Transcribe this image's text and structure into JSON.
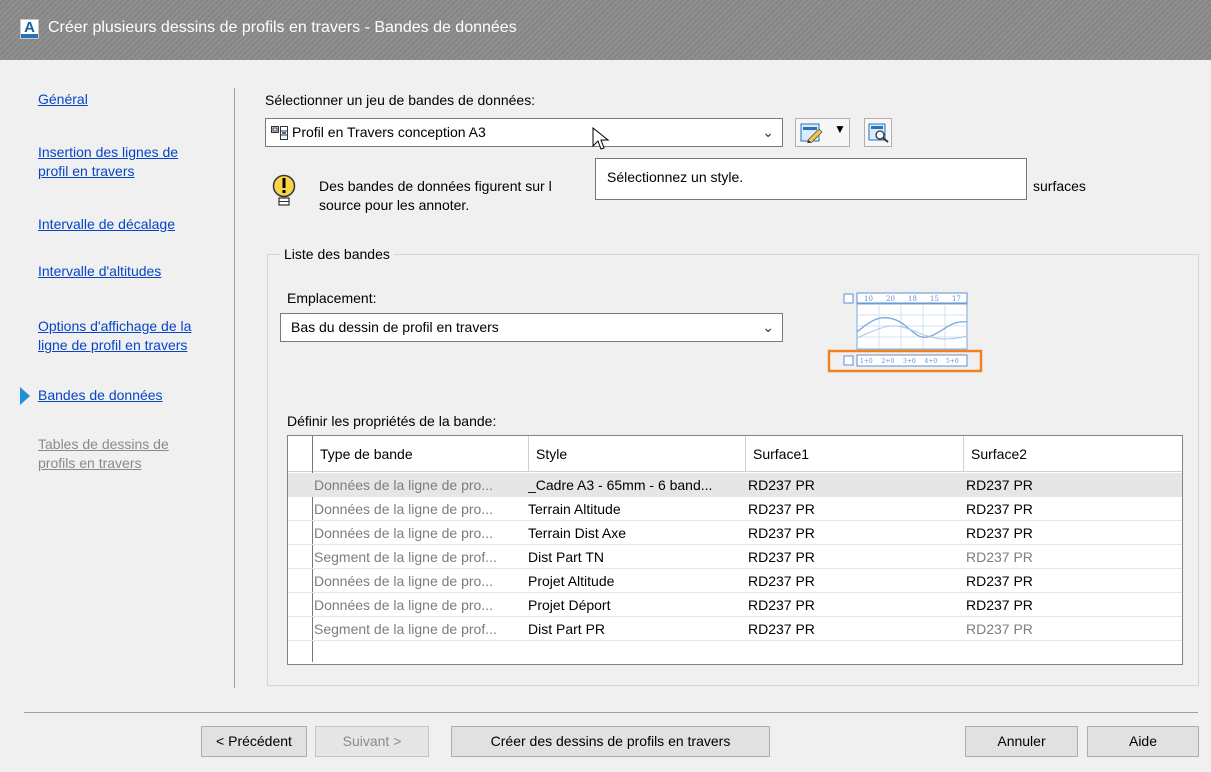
{
  "window": {
    "title": "Créer plusieurs dessins de profils en travers - Bandes de données",
    "icon": "autocad-app-icon",
    "icon_letter": "A"
  },
  "nav": {
    "items": [
      {
        "label_lines": [
          "Général"
        ],
        "active": false,
        "disabled": false
      },
      {
        "label_lines": [
          "Insertion des lignes de",
          "profil en travers"
        ],
        "active": false,
        "disabled": false
      },
      {
        "label_lines": [
          "Intervalle de décalage"
        ],
        "active": false,
        "disabled": false
      },
      {
        "label_lines": [
          "Intervalle d'altitudes"
        ],
        "active": false,
        "disabled": false
      },
      {
        "label_lines": [
          "Options d'affichage de la",
          "ligne de profil en travers"
        ],
        "active": false,
        "disabled": false
      },
      {
        "label_lines": [
          "Bandes de données"
        ],
        "active": true,
        "disabled": false
      },
      {
        "label_lines": [
          "Tables de dessins de",
          "profils en travers"
        ],
        "active": false,
        "disabled": true
      }
    ]
  },
  "bandset": {
    "label": "Sélectionner un jeu de bandes de données:",
    "value": "Profil en Travers conception A3",
    "tooltip": "Sélectionnez un style.",
    "info_text_line1_start": "Des bandes de données figurent sur l",
    "info_text_line1_end": "surfaces",
    "info_text_line2": "source pour les annoter."
  },
  "bandlist": {
    "group_label": "Liste des bandes",
    "location_label": "Emplacement:",
    "location_value": "Bas du dessin de profil en travers",
    "preview_top_values": [
      "10",
      "20",
      "18",
      "15",
      "17"
    ],
    "preview_bottom_values": [
      "1+0",
      "2+0",
      "3+0",
      "4+0",
      "5+0"
    ],
    "highlight_color": "#f0821e"
  },
  "grid": {
    "label": "Définir les propriétés de la bande:",
    "columns": [
      "Type de bande",
      "Style",
      "Surface1",
      "Surface2"
    ],
    "rows": [
      {
        "type": "Données de la ligne de pro...",
        "style": "_Cadre A3 - 65mm - 6 band...",
        "s1": "RD237 PR",
        "s2": "RD237 PR",
        "s2_gray": false,
        "selected": true
      },
      {
        "type": "Données de la ligne de pro...",
        "style": "Terrain Altitude",
        "s1": "RD237 PR",
        "s2": "RD237 PR",
        "s2_gray": false,
        "selected": false
      },
      {
        "type": "Données de la ligne de pro...",
        "style": "Terrain Dist Axe",
        "s1": "RD237 PR",
        "s2": "RD237 PR",
        "s2_gray": false,
        "selected": false
      },
      {
        "type": "Segment de la ligne de prof...",
        "style": "Dist Part TN",
        "s1": "RD237 PR",
        "s2": "RD237 PR",
        "s2_gray": true,
        "selected": false
      },
      {
        "type": "Données de la ligne de pro...",
        "style": "Projet Altitude",
        "s1": "RD237 PR",
        "s2": "RD237 PR",
        "s2_gray": false,
        "selected": false
      },
      {
        "type": "Données de la ligne de pro...",
        "style": "Projet Déport",
        "s1": "RD237 PR",
        "s2": "RD237 PR",
        "s2_gray": false,
        "selected": false
      },
      {
        "type": "Segment de la ligne de prof...",
        "style": "Dist Part PR",
        "s1": "RD237 PR",
        "s2": "RD237 PR",
        "s2_gray": true,
        "selected": false
      }
    ]
  },
  "buttons": {
    "back": "< Précédent",
    "next": "Suivant >",
    "create": "Créer des dessins de profils en travers",
    "cancel": "Annuler",
    "help": "Aide"
  }
}
